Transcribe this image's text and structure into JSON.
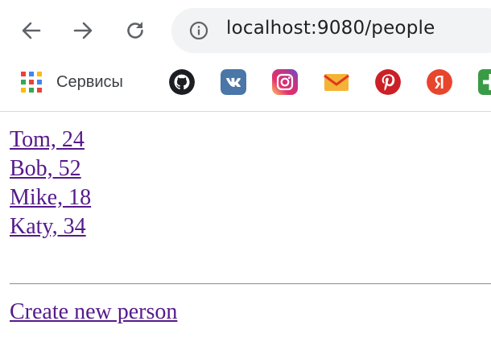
{
  "browser": {
    "url": "localhost:9080/people",
    "bookmarks_bar": {
      "apps_label": "Сервисы",
      "favicons": [
        "github-icon",
        "vk-icon",
        "instagram-icon",
        "gmail-icon",
        "pinterest-icon",
        "yandex-icon",
        "google-plus-icon"
      ]
    }
  },
  "page": {
    "people": [
      {
        "label": "Tom, 24"
      },
      {
        "label": "Bob, 52"
      },
      {
        "label": "Mike, 18"
      },
      {
        "label": "Katy, 34"
      }
    ],
    "create_link": "Create new person",
    "link_color": "#551a8b"
  }
}
